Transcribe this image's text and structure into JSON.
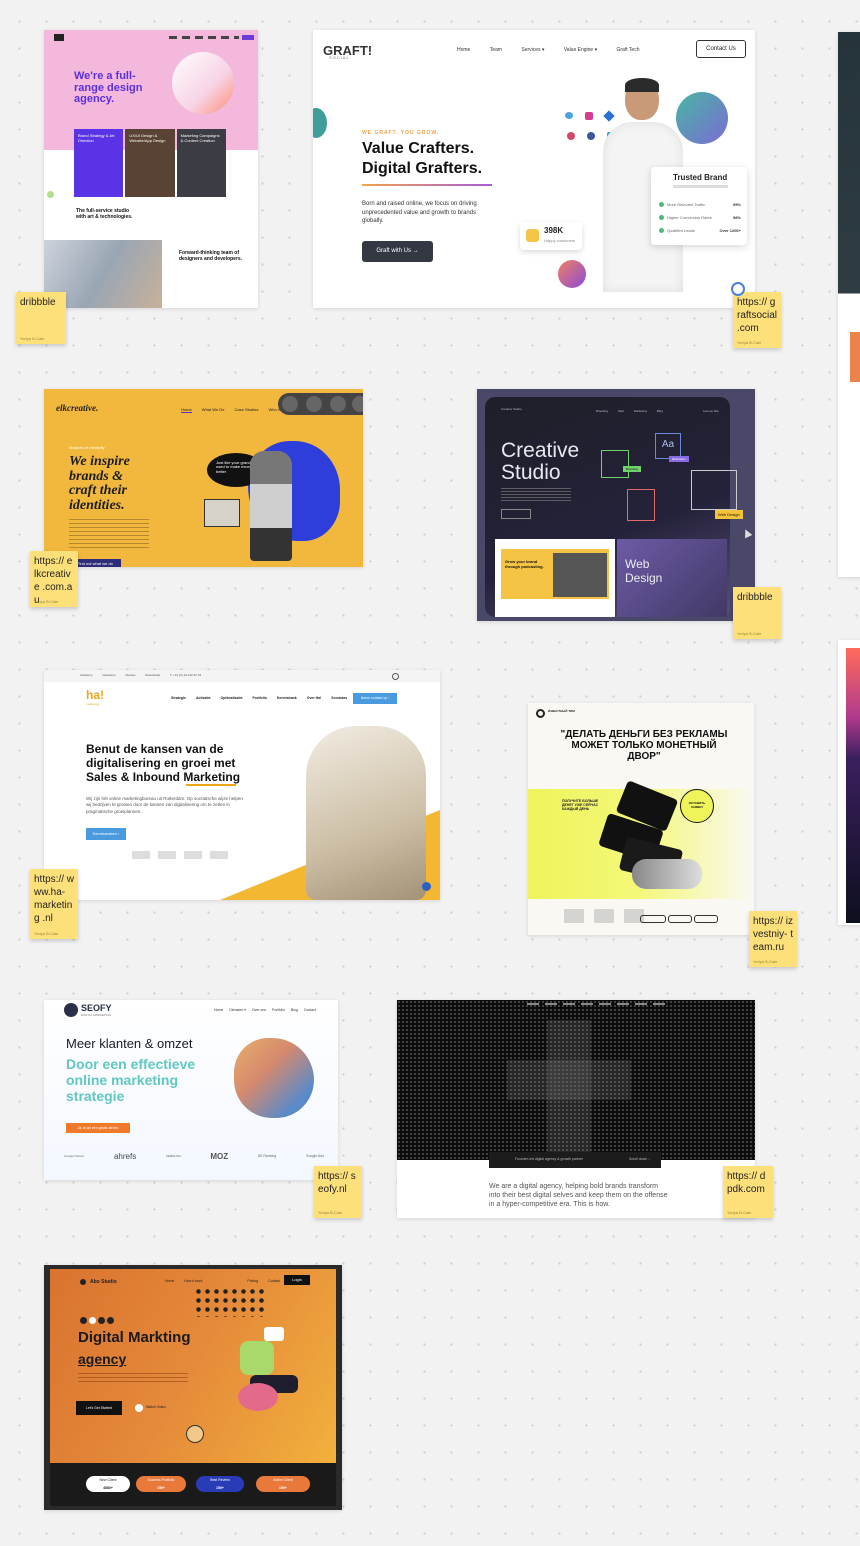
{
  "notes": {
    "n1": {
      "label": "dribbble",
      "sub": "Yoriya B-Cale"
    },
    "n2": {
      "label": "https:// graftsocial .com",
      "sub": "Yoriya B-Cale"
    },
    "n3": {
      "label": "https:// elkcreative .com.au",
      "sub": "Yoriya B-Cale"
    },
    "n4": {
      "label": "dribbble",
      "sub": "Yoriya B-Cale"
    },
    "n5": {
      "label": "https:// www.ha- marketing .nl",
      "sub": "Yoriya B-Cale"
    },
    "n6": {
      "label": "https:// izvestniy- team.ru",
      "sub": "Yoriya B-Cale"
    },
    "n7": {
      "label": "https:// seofy.nl",
      "sub": "Yoriya B-Cale"
    },
    "n8": {
      "label": "https:// dpdk.com",
      "sub": "Yoriya B-Cale"
    }
  },
  "design_agency": {
    "hero": "We're a full-range design agency.",
    "tiles": [
      "Brand Strategy & Art Direction",
      "UX/UI Design & Website/App Design",
      "Marketing Campaigns & Content Creation"
    ],
    "tagline": "The full-service studio with art & technologies.",
    "team": "Forward-thinking team of designers and developers."
  },
  "graft": {
    "logo": "GRAFT!",
    "logo_sub": "SOCIAL",
    "nav": [
      "Home",
      "Team",
      "Services ▾",
      "Value Engine ▾",
      "Graft Tech"
    ],
    "contact": "Contact Us",
    "kicker": "WE GRAFT. YOU GROW.",
    "headline1": "Value Crafters.",
    "headline2": "Digital Grafters.",
    "body": "Born and raised online, we focus on driving unprecedented value and growth to brands globally.",
    "cta": "Graft with Us →",
    "stat": "398K",
    "stat_label": "Happy customers",
    "trusted_title": "Trusted Brand",
    "trusted_rows": [
      {
        "label": "More Relevant Traffic",
        "value": "95%"
      },
      {
        "label": "Higher Conversion Rates",
        "value": "98%"
      },
      {
        "label": "Qualified Leads",
        "value": "Over 1200+"
      }
    ]
  },
  "elk": {
    "logo": "elkcreative.",
    "nav": [
      "Home",
      "What We Do",
      "Case Studies",
      "Who We Are"
    ],
    "kicker": "Masters of creativity.",
    "headline": "We inspire brands & craft their identities.",
    "bubble": "Just like your grandma used to make except better",
    "cta": "Find out what we do"
  },
  "creative_studio": {
    "title1": "Creative",
    "title2": "Studio",
    "tag_branding": "Branding",
    "tag_illustration": "Illustration",
    "tag_web": "Web Design",
    "sub_title1": "Web",
    "sub_title2": "Design",
    "podcast": "Grow your brand through podcasting.",
    "menu": [
      "Branding",
      "Web",
      "Marketing",
      "Blog"
    ],
    "nav_label": "Leteme Idle",
    "logo": "Creative Studio"
  },
  "ha": {
    "top": [
      "Academy",
      "Vacatures",
      "Nieuws",
      "Downloads",
      "T: +31 (0) 10 412 22 78"
    ],
    "logo": "ha!",
    "logo_sub": "marketing",
    "nav": [
      "Strategie",
      "Activatie",
      "Optimalisatie",
      "Portfolio",
      "Kennisbank",
      "Over Ha!",
      "Seminars"
    ],
    "nav_cta": "Neem contact op  ›",
    "headline1": "Benut de kansen van de",
    "headline2": "digitalisering en groei met",
    "headline3": "Sales & Inbound Marketing",
    "body": "Wij zijn hét online marketingbureau uit Rotterdam. Op socratische wijze helpen wij bedrijven te groeien door de kansen van digitalisering om te zetten in pragmatische groeiplannen.",
    "cta": "Kennismaken  ›"
  },
  "izvestniy": {
    "logo": "ИЗВЕСТНЫЙ ТИМ",
    "headline": "\"ДЕЛАТЬ ДЕНЬГИ БЕЗ РЕКЛАМЫ МОЖЕТ ТОЛЬКО МОНЕТНЫЙ ДВОР\"",
    "side": "ПОЛУЧИТЕ БОЛЬШЕ ДЕНЕГ УЖЕ СЕЙЧАС КАЖДЫЙ ДЕНЬ",
    "circle": "ОСТАВИТЬ ЗАЯВКУ"
  },
  "seofy": {
    "logo": "SEOFY",
    "logo_sub": "DIGITAL MARKETING",
    "nav": [
      "Home",
      "Diensten ▾",
      "Over ons",
      "Portfolio",
      "Blog",
      "Contact"
    ],
    "h1": "Meer klanten & omzet",
    "h2a": "Door een effectieve",
    "h2b": "online marketing",
    "h2c": "strategie",
    "cta": "Ja, ik wil een gratis advies",
    "logos": [
      "Google Partner",
      "ahrefs",
      "SEMRUSH",
      "MOZ",
      "SE Ranking",
      "Google Ads"
    ]
  },
  "dpdk": {
    "bar_text": "Founder-led digital agency & growth partner",
    "bar_right": "Scroll down ↓",
    "body": "We are a digital agency, helping bold brands transform into their best digital selves and keep them on the offense in a hyper-competitive era. This is how."
  },
  "abo": {
    "logo": "Abo Studio",
    "nav": [
      "Home",
      "How it work",
      "Pricing",
      "Contact"
    ],
    "login": "Login",
    "h1": "Digital Markting",
    "h2": "agency",
    "cta": "Let's Get Started",
    "watch": "Watch Video",
    "stats": [
      {
        "label": "New Client",
        "value": "4580+"
      },
      {
        "label": "Success Portfolio",
        "value": "150+"
      },
      {
        "label": "Best Review",
        "value": "150+"
      },
      {
        "label": "Active Client",
        "value": "150+"
      }
    ]
  }
}
